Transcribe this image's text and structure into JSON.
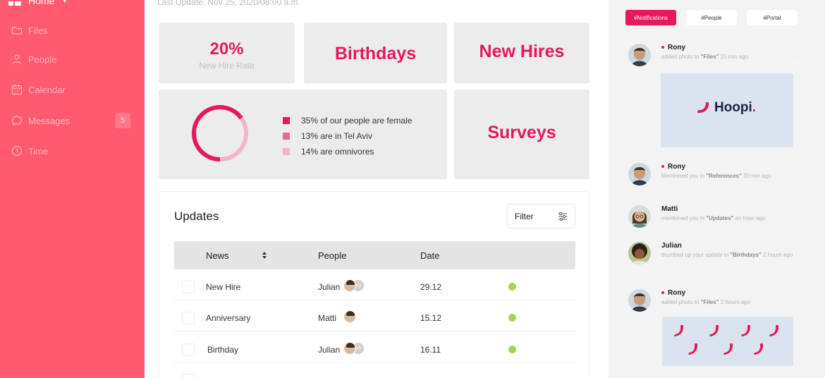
{
  "sidebar": {
    "home_label": "Home",
    "items": [
      {
        "label": "Files",
        "icon": "folder-icon"
      },
      {
        "label": "People",
        "icon": "person-icon"
      },
      {
        "label": "Calendar",
        "icon": "calendar-icon"
      },
      {
        "label": "Messages",
        "icon": "chat-icon",
        "badge": "5"
      },
      {
        "label": "Time",
        "icon": "clock-icon"
      }
    ],
    "color": "#ff5a6e"
  },
  "header": {
    "last_update": "Last Update: Nov 25, 2020/08:00 a.m."
  },
  "stats": {
    "hire_rate_value": "20%",
    "hire_rate_label": "New Hire Rate",
    "birthdays": "Birthdays",
    "new_hires": "New Hires",
    "surveys": "Surveys",
    "donut_fraction": 0.65,
    "legend": [
      {
        "text": "35% of our people are female",
        "color": "#e5195b"
      },
      {
        "text": "13% are in Tel Aviv",
        "color": "#e46a8c"
      },
      {
        "text": "14% are omnivores",
        "color": "#f2b4c6"
      }
    ]
  },
  "updates": {
    "title": "Updates",
    "filter_label": "Filter",
    "columns": [
      "News",
      "People",
      "Date"
    ],
    "rows": [
      {
        "news": "New Hire",
        "person": "Julian",
        "more": "+3",
        "date": "29.12",
        "status": "active"
      },
      {
        "news": "Anniversary",
        "person": "Matti",
        "more": "",
        "date": "15.12",
        "status": "active"
      },
      {
        "news": "Birthday",
        "person": "Julian",
        "more": "+3",
        "date": "16.11",
        "status": "active"
      }
    ]
  },
  "right_panel": {
    "tabs": [
      "#Notifications",
      "#People",
      "#Portal"
    ],
    "feed": [
      {
        "name": "Rony",
        "pre": "added photo to ",
        "target": "\"Files\"",
        "post": " 15 min ago"
      },
      {
        "name": "Rony",
        "pre": "Mentioned you in ",
        "target": "\"References\"",
        "post": " 30 min ago"
      },
      {
        "name": "Matti",
        "pre": "mentioned you in ",
        "target": "\"Updates\"",
        "post": "  an hour ago"
      },
      {
        "name": "Julian",
        "pre": "thumbed up your update  in ",
        "target": "\"Birthdays\"",
        "post": " 2 hours ago"
      },
      {
        "name": "Rony",
        "pre": "added photo to ",
        "target": "\"Files\"",
        "post": " 3 hours ago"
      }
    ],
    "more_label": "···",
    "logo_text": "Hoopi",
    "logo_accent": "."
  },
  "accent": "#e5195b",
  "status_green": "#a3d84e"
}
